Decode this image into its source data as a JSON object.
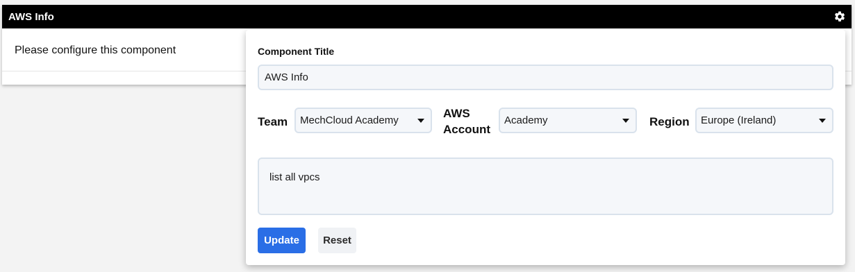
{
  "widget": {
    "title": "AWS Info",
    "message": "Please configure this component",
    "settings_icon": "gear-icon"
  },
  "config_panel": {
    "component_title_label": "Component Title",
    "component_title_value": "AWS Info",
    "team_label": "Team",
    "team_value": "MechCloud Academy",
    "account_label_line1": "AWS",
    "account_label_line2": "Account",
    "account_value": "Academy",
    "region_label": "Region",
    "region_value": "Europe (Ireland)",
    "query_value": "list all vpcs",
    "update_label": "Update",
    "reset_label": "Reset",
    "colors": {
      "primary": "#2a6ee6",
      "titlebar": "#000000",
      "field_bg": "#f5f7fa",
      "field_border": "#d9e2ec"
    }
  }
}
